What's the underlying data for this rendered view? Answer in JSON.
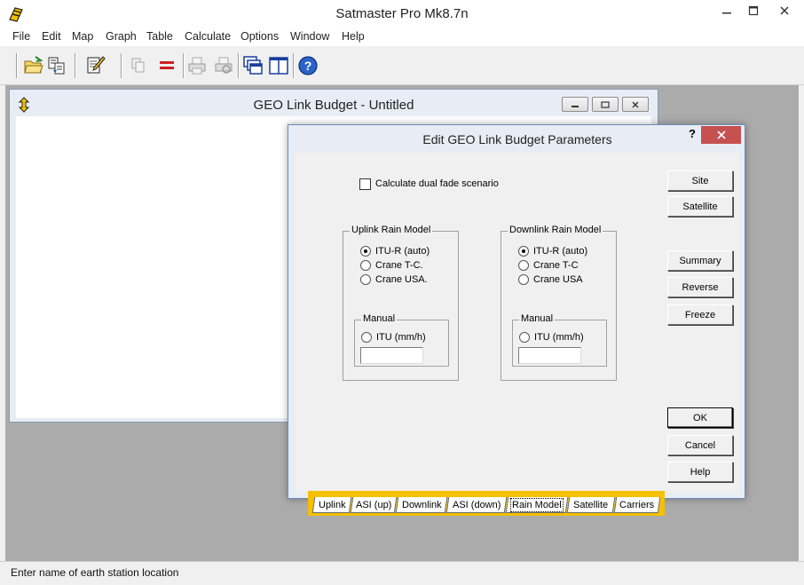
{
  "app": {
    "title": "Satmaster Pro Mk8.7n"
  },
  "menu": [
    "File",
    "Edit",
    "Map",
    "Graph",
    "Table",
    "Calculate",
    "Options",
    "Window",
    "Help"
  ],
  "child_window": {
    "title": "GEO Link Budget - Untitled"
  },
  "dialog": {
    "title": "Edit GEO Link Budget Parameters",
    "help_glyph": "?",
    "dual_fade_label": "Calculate dual fade scenario",
    "dual_fade_checked": false,
    "uplink": {
      "caption": "Uplink Rain Model",
      "options": [
        "ITU-R (auto)",
        "Crane T-C.",
        "Crane USA."
      ],
      "selected": "ITU-R (auto)",
      "manual_caption": "Manual",
      "manual_option": "ITU (mm/h)",
      "manual_value": ""
    },
    "downlink": {
      "caption": "Downlink Rain Model",
      "options": [
        "ITU-R (auto)",
        "Crane T-C",
        "Crane USA"
      ],
      "selected": "ITU-R (auto)",
      "manual_caption": "Manual",
      "manual_option": "ITU (mm/h)",
      "manual_value": ""
    },
    "buttons": {
      "site": "Site",
      "satellite": "Satellite",
      "summary": "Summary",
      "reverse": "Reverse",
      "freeze": "Freeze",
      "ok": "OK",
      "cancel": "Cancel",
      "help": "Help"
    },
    "tabs": [
      "Uplink",
      "ASI (up)",
      "Downlink",
      "ASI (down)",
      "Rain Model",
      "Satellite",
      "Carriers"
    ],
    "active_tab": "Rain Model"
  },
  "status": {
    "text": "Enter name of earth station location"
  },
  "colors": {
    "tab_strip": "#f5c000",
    "close_red": "#c75050",
    "mdi_background": "#ababab"
  },
  "toolbar_icons": [
    "open-folder-icon",
    "import-icon",
    "edit-notepad-icon",
    "copy-icon",
    "equals-icon",
    "print-icon",
    "print-preview-icon",
    "cascade-windows-icon",
    "tile-windows-icon",
    "help-icon"
  ]
}
